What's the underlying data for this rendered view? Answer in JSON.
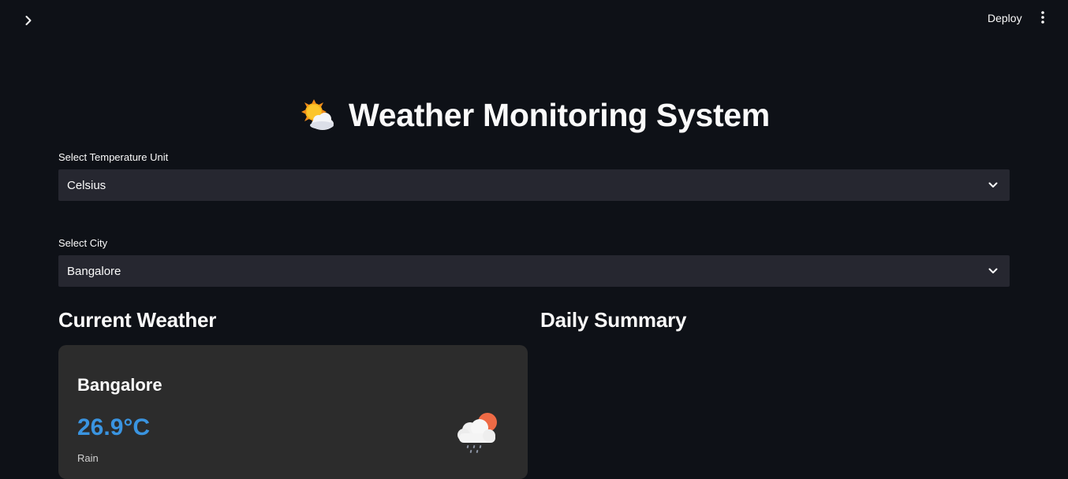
{
  "header": {
    "deploy_label": "Deploy"
  },
  "page": {
    "title": "Weather Monitoring System",
    "title_icon": "sun-behind-cloud-emoji"
  },
  "unit_select": {
    "label": "Select Temperature Unit",
    "value": "Celsius"
  },
  "city_select": {
    "label": "Select City",
    "value": "Bangalore"
  },
  "current_weather": {
    "heading": "Current Weather",
    "city": "Bangalore",
    "temperature": "26.9°C",
    "condition": "Rain",
    "icon": "rain-cloud-sun-icon"
  },
  "daily_summary": {
    "heading": "Daily Summary"
  },
  "colors": {
    "background": "#0e1117",
    "input_bg": "#262730",
    "card_bg": "#2c2c2c",
    "temp_accent": "#3a94e0"
  }
}
